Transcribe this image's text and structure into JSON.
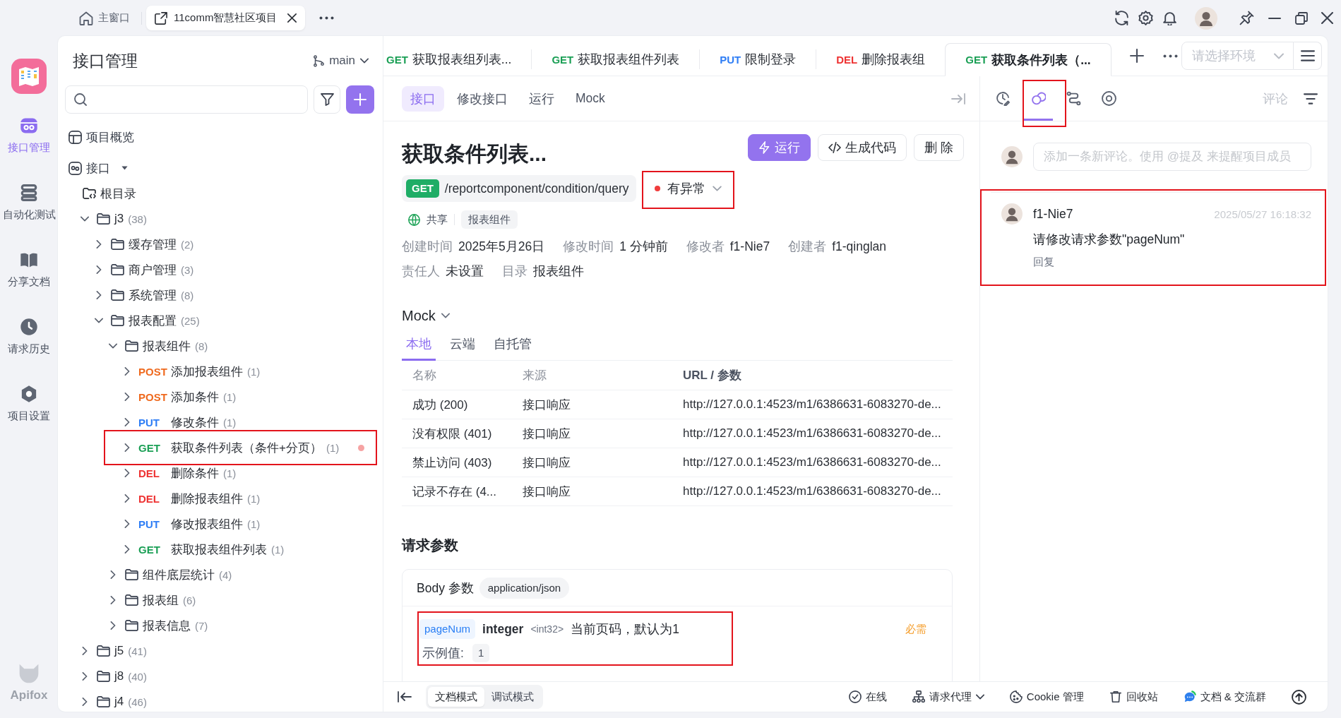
{
  "window": {
    "tabs": [
      {
        "kind": "home",
        "label": "主窗口",
        "selected": false
      },
      {
        "kind": "project",
        "label": "11comm智慧社区项目",
        "selected": true
      }
    ]
  },
  "nav": {
    "items": [
      {
        "kind": "api",
        "label": "接口管理",
        "selected": true
      },
      {
        "kind": "test",
        "label": "自动化测试",
        "selected": false
      },
      {
        "kind": "docs",
        "label": "分享文档",
        "selected": false
      },
      {
        "kind": "history",
        "label": "请求历史",
        "selected": false
      },
      {
        "kind": "settings",
        "label": "项目设置",
        "selected": false
      }
    ],
    "brand": "Apifox"
  },
  "sidebar": {
    "title": "接口管理",
    "branch": "main",
    "overview": "项目概览",
    "api_section": "接口",
    "root": "根目录",
    "tree": [
      {
        "kind": "folder",
        "name": "j3",
        "count": "(38)",
        "expanded": true,
        "children": [
          {
            "kind": "folder",
            "name": "缓存管理",
            "count": "(2)",
            "expanded": false
          },
          {
            "kind": "folder",
            "name": "商户管理",
            "count": "(3)",
            "expanded": false
          },
          {
            "kind": "folder",
            "name": "系统管理",
            "count": "(8)",
            "expanded": false
          },
          {
            "kind": "folder",
            "name": "报表配置",
            "count": "(25)",
            "expanded": true,
            "children": [
              {
                "kind": "folder",
                "name": "报表组件",
                "count": "(8)",
                "expanded": true,
                "children": [
                  {
                    "kind": "endpoint",
                    "method": "POST",
                    "color": "#ef6a1f",
                    "name": "添加报表组件",
                    "count": "(1)",
                    "expanded": false,
                    "dot": false,
                    "highlighted": false
                  },
                  {
                    "kind": "endpoint",
                    "method": "POST",
                    "color": "#ef6a1f",
                    "name": "添加条件",
                    "count": "(1)",
                    "expanded": false,
                    "dot": false,
                    "highlighted": false
                  },
                  {
                    "kind": "endpoint",
                    "method": "PUT",
                    "color": "#2f7ef5",
                    "name": "修改条件",
                    "count": "(1)",
                    "expanded": false,
                    "dot": false,
                    "highlighted": false
                  },
                  {
                    "kind": "endpoint",
                    "method": "GET",
                    "color": "#1a9f55",
                    "name": "获取条件列表（条件+分页）",
                    "count": "(1)",
                    "expanded": false,
                    "dot": true,
                    "highlighted": true
                  },
                  {
                    "kind": "endpoint",
                    "method": "DEL",
                    "color": "#ee3333",
                    "name": "删除条件",
                    "count": "(1)",
                    "expanded": false,
                    "dot": false,
                    "highlighted": false
                  },
                  {
                    "kind": "endpoint",
                    "method": "DEL",
                    "color": "#ee3333",
                    "name": "删除报表组件",
                    "count": "(1)",
                    "expanded": false,
                    "dot": false,
                    "highlighted": false
                  },
                  {
                    "kind": "endpoint",
                    "method": "PUT",
                    "color": "#2f7ef5",
                    "name": "修改报表组件",
                    "count": "(1)",
                    "expanded": false,
                    "dot": false,
                    "highlighted": false
                  },
                  {
                    "kind": "endpoint",
                    "method": "GET",
                    "color": "#1a9f55",
                    "name": "获取报表组件列表",
                    "count": "(1)",
                    "expanded": false,
                    "dot": false,
                    "highlighted": false
                  }
                ]
              },
              {
                "kind": "folder",
                "name": "组件底层统计",
                "count": "(4)",
                "expanded": false
              },
              {
                "kind": "folder",
                "name": "报表组",
                "count": "(6)",
                "expanded": false
              },
              {
                "kind": "folder",
                "name": "报表信息",
                "count": "(7)",
                "expanded": false
              }
            ]
          }
        ]
      },
      {
        "kind": "folder",
        "name": "j5",
        "count": "(41)",
        "expanded": false
      },
      {
        "kind": "folder",
        "name": "j8",
        "count": "(40)",
        "expanded": false
      },
      {
        "kind": "folder",
        "name": "j4",
        "count": "(46)",
        "expanded": false
      }
    ]
  },
  "tabs": [
    {
      "method": "GET",
      "color": "#1a9f55",
      "label": "获取报表组列表...",
      "selected": false
    },
    {
      "method": "GET",
      "color": "#1a9f55",
      "label": "获取报表组件列表",
      "selected": false
    },
    {
      "method": "PUT",
      "color": "#2f7ef5",
      "label": "限制登录",
      "selected": false
    },
    {
      "method": "DEL",
      "color": "#ee3333",
      "label": "删除报表组",
      "selected": false
    },
    {
      "method": "GET",
      "color": "#1a9f55",
      "label": "获取条件列表（...",
      "selected": true
    }
  ],
  "environment": {
    "placeholder": "请选择环境"
  },
  "subtabs": [
    {
      "label": "接口",
      "selected": true
    },
    {
      "label": "修改接口",
      "selected": false
    },
    {
      "label": "运行",
      "selected": false
    },
    {
      "label": "Mock",
      "selected": false
    }
  ],
  "endpoint": {
    "title": "获取条件列表...",
    "actions": [
      {
        "kind": "run",
        "label": "运行"
      },
      {
        "kind": "code",
        "label": "生成代码"
      },
      {
        "kind": "delete",
        "label": "删 除"
      }
    ],
    "method": "GET",
    "path": "/reportcomponent/condition/query",
    "status": {
      "label": "有异常",
      "color": "#f03d3d",
      "highlighted": true
    },
    "visibility": "共享",
    "folder_tag": "报表组件",
    "meta": [
      [
        {
          "label": "创建时间",
          "value": "2025年5月26日"
        },
        {
          "label": "修改时间",
          "value": "1 分钟前"
        },
        {
          "label": "修改者",
          "value": "f1-Nie7"
        },
        {
          "label": "创建者",
          "value": "f1-qinglan"
        }
      ],
      [
        {
          "label": "责任人",
          "value": "未设置"
        },
        {
          "label": "目录",
          "value": "报表组件"
        }
      ]
    ]
  },
  "mock": {
    "title": "Mock",
    "tabs": [
      {
        "label": "本地",
        "selected": true
      },
      {
        "label": "云端",
        "selected": false
      },
      {
        "label": "自托管",
        "selected": false
      }
    ],
    "columns": [
      "名称",
      "来源",
      "URL / 参数"
    ],
    "rows": [
      [
        "成功 (200)",
        "接口响应",
        "http://127.0.0.1:4523/m1/6386631-6083270-de..."
      ],
      [
        "没有权限 (401)",
        "接口响应",
        "http://127.0.0.1:4523/m1/6386631-6083270-de..."
      ],
      [
        "禁止访问 (403)",
        "接口响应",
        "http://127.0.0.1:4523/m1/6386631-6083270-de..."
      ],
      [
        "记录不存在 (4...",
        "接口响应",
        "http://127.0.0.1:4523/m1/6386631-6083270-de..."
      ]
    ]
  },
  "request": {
    "title": "请求参数",
    "body_label": "Body 参数",
    "content_type": "application/json",
    "params": [
      {
        "name": "pageNum",
        "type": "integer",
        "format": "<int32>",
        "description": "当前页码，默认为1",
        "required": "必需",
        "example_label": "示例值:",
        "example": "1",
        "highlighted": true
      }
    ]
  },
  "status_bar": {
    "modes": [
      {
        "label": "文档模式",
        "selected": true
      },
      {
        "label": "调试模式",
        "selected": false
      }
    ],
    "items": [
      {
        "kind": "online",
        "label": "在线",
        "dropdown": false
      },
      {
        "kind": "proxy",
        "label": "请求代理",
        "dropdown": true
      },
      {
        "kind": "cookie",
        "label": "Cookie 管理",
        "dropdown": false
      },
      {
        "kind": "trash",
        "label": "回收站",
        "dropdown": false
      },
      {
        "kind": "community",
        "label": "文档 & 交流群",
        "dropdown": false
      }
    ]
  },
  "comments_panel": {
    "tools": [
      {
        "kind": "history",
        "selected": false,
        "highlighted": false
      },
      {
        "kind": "comment",
        "selected": true,
        "highlighted": true
      },
      {
        "kind": "flow",
        "selected": false,
        "highlighted": false
      },
      {
        "kind": "target",
        "selected": false,
        "highlighted": false
      }
    ],
    "title": "评论",
    "input": {
      "placeholder": "添加一条新评论。使用 @提及 来提醒项目成员"
    },
    "comments": [
      {
        "author": "f1-Nie7",
        "time": "2025/05/27 16:18:32",
        "text": "请修改请求参数\"pageNum\"",
        "reply": "回复",
        "highlighted": true
      }
    ]
  }
}
